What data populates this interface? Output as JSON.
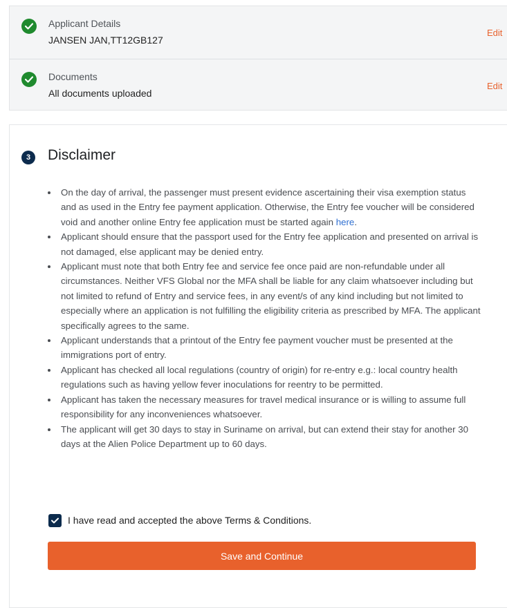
{
  "summary": {
    "rows": [
      {
        "title": "Applicant Details",
        "value": "JANSEN JAN,TT12GB127",
        "edit_label": "Edit"
      },
      {
        "title": "Documents",
        "value": "All documents uploaded",
        "edit_label": "Edit"
      }
    ]
  },
  "disclaimer": {
    "step_number": "3",
    "title": "Disclaimer",
    "terms": [
      {
        "text": "On the day of arrival, the passenger must present evidence ascertaining their visa exemption status and as used in the Entry fee payment application. Otherwise, the Entry fee voucher will be considered void and another online Entry fee application must be started again ",
        "link_text": "here",
        "suffix": "."
      },
      {
        "text": "Applicant should ensure that the passport used for the Entry fee application and presented on arrival is not damaged, else applicant may be denied entry."
      },
      {
        "text": "Applicant must note that both Entry fee and service fee once paid are non-refundable under all circumstances. Neither VFS Global nor the MFA shall be liable for any claim whatsoever including but not limited to refund of Entry and service fees, in any event/s of any kind including but not limited to especially where an application is not fulfilling the eligibility criteria as prescribed by MFA. The applicant specifically agrees to the same."
      },
      {
        "text": "Applicant understands that a printout of the Entry fee payment voucher must be presented at the immigrations port of entry."
      },
      {
        "text": "Applicant has checked all local regulations (country of origin) for re-entry e.g.: local country health regulations such as having yellow fever inoculations for reentry to be permitted."
      },
      {
        "text": "Applicant has taken the necessary measures for travel medical insurance or is willing to assume full responsibility for any inconveniences whatsoever."
      },
      {
        "text": "The applicant will get 30 days to stay in Suriname on arrival, but can extend their stay for another 30 days at the Alien Police Department up to 60 days."
      }
    ],
    "consent_checked": true,
    "consent_label": "I have read and accepted the above Terms & Conditions.",
    "save_button_label": "Save and Continue"
  },
  "icons": {
    "completed": "check-circle-icon",
    "checkbox": "checkmark-icon"
  },
  "colors": {
    "accent": "#e8612c",
    "success": "#1f8a2e",
    "navy": "#0c2b4d",
    "link": "#2f6fd1"
  }
}
